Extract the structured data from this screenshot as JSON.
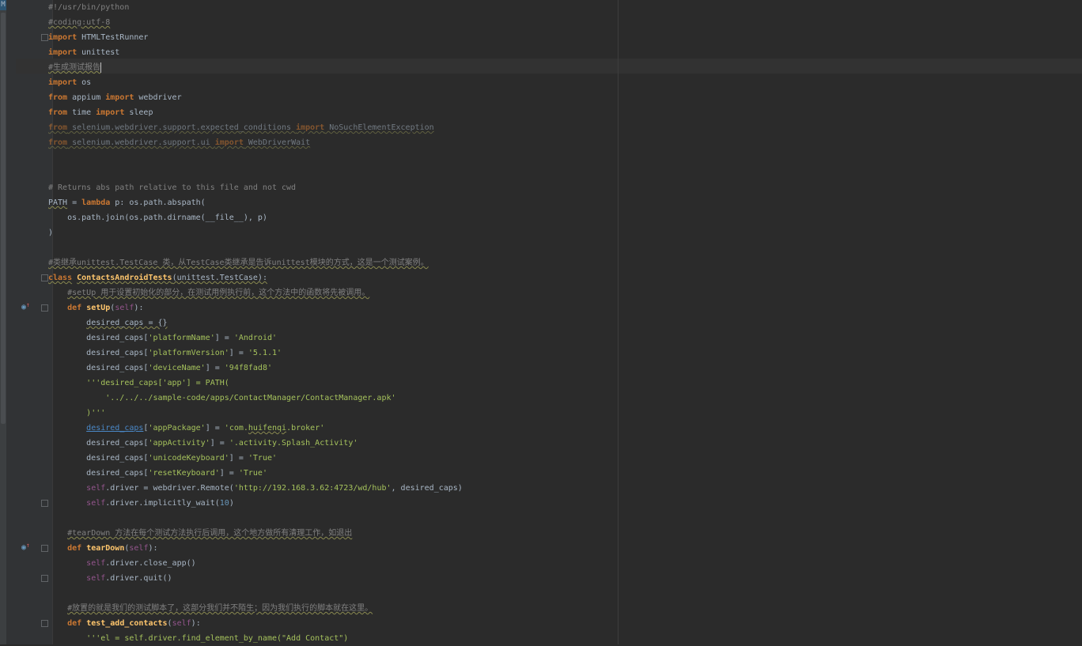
{
  "editor": {
    "language": "python",
    "current_line": 5,
    "lines": [
      [
        [
          "cmt",
          "#!/usr/bin/python"
        ]
      ],
      [
        [
          "cmt wavy",
          "#coding:utf-8"
        ]
      ],
      [
        [
          "kw",
          "import"
        ],
        [
          "p",
          " HTMLTestRunner"
        ]
      ],
      [
        [
          "kw",
          "import"
        ],
        [
          "p",
          " unittest"
        ]
      ],
      [
        [
          "cmt wavy",
          "#生成测试报告"
        ],
        [
          "caret",
          ""
        ]
      ],
      [
        [
          "kw",
          "import"
        ],
        [
          "p",
          " os"
        ]
      ],
      [
        [
          "kw",
          "from"
        ],
        [
          "p",
          " appium "
        ],
        [
          "kw",
          "import"
        ],
        [
          "p",
          " webdriver"
        ]
      ],
      [
        [
          "kw",
          "from"
        ],
        [
          "p",
          " time "
        ],
        [
          "kw",
          "import"
        ],
        [
          "p",
          " sleep"
        ]
      ],
      [
        [
          "kw dim wavy",
          "from"
        ],
        [
          "p dim wavy",
          " selenium.webdriver.support.expected_conditions "
        ],
        [
          "kw dim wavy",
          "import"
        ],
        [
          "p dim wavy",
          " NoSuchElementException"
        ]
      ],
      [
        [
          "kw dim wavy",
          "from"
        ],
        [
          "p dim wavy",
          " selenium.webdriver.support.ui "
        ],
        [
          "kw dim wavy",
          "import"
        ],
        [
          "p dim wavy",
          " WebDriverWait"
        ]
      ],
      [],
      [],
      [
        [
          "cmt",
          "# Returns abs path relative to this file and not cwd"
        ]
      ],
      [
        [
          "p wavy",
          "PATH"
        ],
        [
          "p",
          " = "
        ],
        [
          "kw",
          "lambda"
        ],
        [
          "p",
          " p: os.path.abspath("
        ]
      ],
      [
        [
          "p",
          "    os.path.join(os.path.dirname(__file__), p)"
        ]
      ],
      [
        [
          "p",
          ")"
        ]
      ],
      [],
      [
        [
          "cmt wavy",
          "#类继承unittest.TestCase 类，从TestCase类继承是告诉unittest模块的方式，这是一个测试案例。"
        ]
      ],
      [
        [
          "kw wavy",
          "class"
        ],
        [
          "p",
          " "
        ],
        [
          "fn wavy",
          "ContactsAndroidTests"
        ],
        [
          "p wavy",
          "(unittest.TestCase):"
        ]
      ],
      [
        [
          "p",
          "    "
        ],
        [
          "cmt wavy",
          "#setUp 用于设置初始化的部分，在测试用例执行前，这个方法中的函数将先被调用。"
        ]
      ],
      [
        [
          "p",
          "    "
        ],
        [
          "kw",
          "def"
        ],
        [
          "p",
          " "
        ],
        [
          "fn",
          "setUp"
        ],
        [
          "p",
          "("
        ],
        [
          "self",
          "self"
        ],
        [
          "p",
          "):"
        ]
      ],
      [
        [
          "p",
          "        "
        ],
        [
          "p wavy",
          "desired_caps = {}"
        ]
      ],
      [
        [
          "p",
          "        desired_caps["
        ],
        [
          "str",
          "'platformName'"
        ],
        [
          "p",
          "] = "
        ],
        [
          "str",
          "'Android'"
        ]
      ],
      [
        [
          "p",
          "        desired_caps["
        ],
        [
          "str",
          "'platformVersion'"
        ],
        [
          "p",
          "] = "
        ],
        [
          "str",
          "'5.1.1'"
        ]
      ],
      [
        [
          "p",
          "        desired_caps["
        ],
        [
          "str",
          "'deviceName'"
        ],
        [
          "p",
          "] = "
        ],
        [
          "str",
          "'94f8fad8'"
        ]
      ],
      [
        [
          "p",
          "        "
        ],
        [
          "str",
          "'''desired_caps['app'] = PATH("
        ]
      ],
      [
        [
          "p",
          "            "
        ],
        [
          "str",
          "'../../../sample-code/apps/ContactManager/ContactManager.apk'"
        ]
      ],
      [
        [
          "p",
          "        "
        ],
        [
          "str",
          ")'''"
        ]
      ],
      [
        [
          "p",
          "        "
        ],
        [
          "link",
          "desired_caps"
        ],
        [
          "p",
          "["
        ],
        [
          "str",
          "'appPackage'"
        ],
        [
          "p",
          "] = "
        ],
        [
          "str",
          "'com."
        ],
        [
          "str wavy",
          "huifenqi"
        ],
        [
          "str",
          ".broker'"
        ]
      ],
      [
        [
          "p",
          "        desired_caps["
        ],
        [
          "str",
          "'appActivity'"
        ],
        [
          "p",
          "] = "
        ],
        [
          "str",
          "'.activity.Splash_Activity'"
        ]
      ],
      [
        [
          "p",
          "        desired_caps["
        ],
        [
          "str",
          "'unicodeKeyboard'"
        ],
        [
          "p",
          "] = "
        ],
        [
          "str",
          "'True'"
        ]
      ],
      [
        [
          "p",
          "        desired_caps["
        ],
        [
          "str",
          "'resetKeyboard'"
        ],
        [
          "p",
          "] = "
        ],
        [
          "str",
          "'True'"
        ]
      ],
      [
        [
          "p",
          "        "
        ],
        [
          "self",
          "self"
        ],
        [
          "p",
          ".driver = webdriver.Remote("
        ],
        [
          "str",
          "'http://192.168.3.62:4723/wd/hub'"
        ],
        [
          "p",
          ", desired_caps)"
        ]
      ],
      [
        [
          "p",
          "        "
        ],
        [
          "self",
          "self"
        ],
        [
          "p",
          ".driver.implicitly_wait("
        ],
        [
          "num",
          "10"
        ],
        [
          "p",
          ")"
        ]
      ],
      [],
      [
        [
          "p",
          "    "
        ],
        [
          "cmt wavy",
          "#tearDown 方法在每个测试方法执行后调用，这个地方做所有清理工作，如退出"
        ]
      ],
      [
        [
          "p",
          "    "
        ],
        [
          "kw",
          "def"
        ],
        [
          "p",
          " "
        ],
        [
          "fn",
          "tearDown"
        ],
        [
          "p",
          "("
        ],
        [
          "self",
          "self"
        ],
        [
          "p",
          "):"
        ]
      ],
      [
        [
          "p",
          "        "
        ],
        [
          "self",
          "self"
        ],
        [
          "p",
          ".driver.close_app()"
        ]
      ],
      [
        [
          "p",
          "        "
        ],
        [
          "self",
          "self"
        ],
        [
          "p",
          ".driver.quit()"
        ]
      ],
      [],
      [
        [
          "p",
          "    "
        ],
        [
          "cmt wavy",
          "#放置的就是我们的测试脚本了，这部分我们并不陌生；因为我们执行的脚本就在这里。"
        ]
      ],
      [
        [
          "p",
          "    "
        ],
        [
          "kw",
          "def"
        ],
        [
          "p",
          " "
        ],
        [
          "fn",
          "test_add_contacts"
        ],
        [
          "p",
          "("
        ],
        [
          "self",
          "self"
        ],
        [
          "p",
          "):"
        ]
      ],
      [
        [
          "p",
          "        "
        ],
        [
          "str",
          "'''el = self.driver.find_element_by_name(\"Add Contact\")"
        ]
      ]
    ]
  },
  "gutter": {
    "fold_start_lines": [
      3,
      19,
      21,
      37,
      42
    ],
    "fold_end_lines": [
      34,
      39
    ],
    "override_lines": [
      21,
      37
    ],
    "left_tab_marker": "M"
  }
}
